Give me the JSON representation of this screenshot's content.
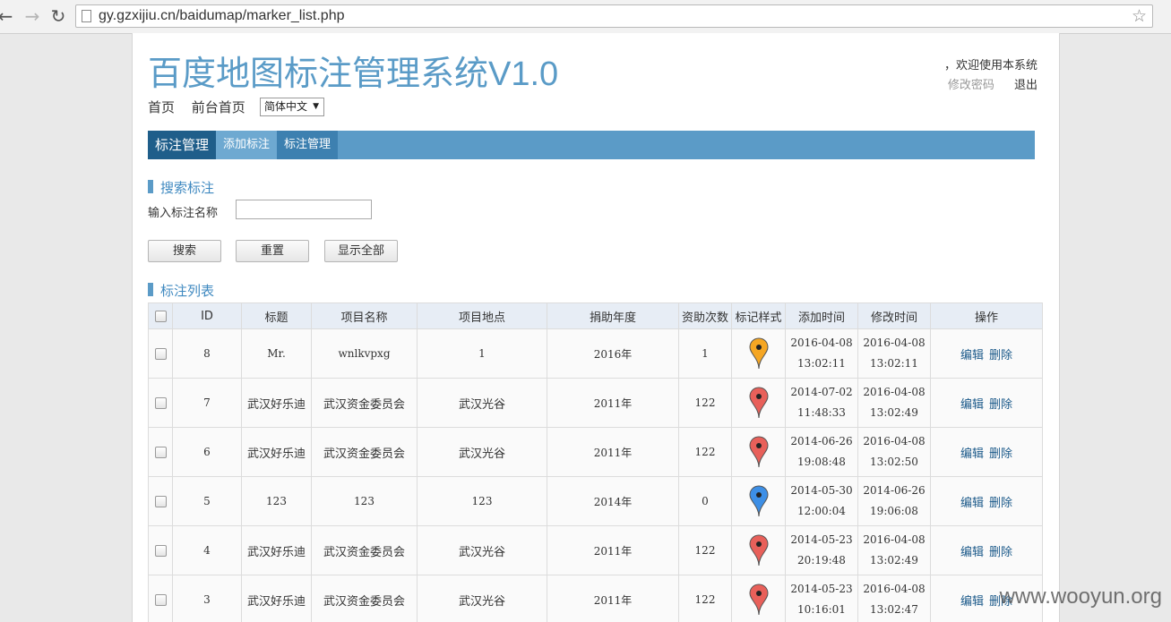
{
  "browser": {
    "url": "gy.gzxijiu.cn/baidumap/marker_list.php"
  },
  "header": {
    "title": "百度地图标注管理系统V1.0",
    "welcome": "，欢迎使用本系统",
    "change_password": "修改密码",
    "logout": "退出",
    "nav_home": "首页",
    "nav_front": "前台首页",
    "language": "简体中文"
  },
  "menu": {
    "active": "标注管理",
    "add": "添加标注",
    "manage": "标注管理"
  },
  "search": {
    "section_title": "搜索标注",
    "field_label": "输入标注名称",
    "input_value": "",
    "btn_search": "搜索",
    "btn_reset": "重置",
    "btn_show_all": "显示全部"
  },
  "list": {
    "section_title": "标注列表",
    "columns": [
      "",
      "ID",
      "标题",
      "项目名称",
      "项目地点",
      "捐助年度",
      "资助次数",
      "标记样式",
      "添加时间",
      "修改时间",
      "操作"
    ],
    "edit_label": "编辑",
    "delete_label": "删除",
    "rows": [
      {
        "id": "8",
        "title": "Mr.",
        "project": "wnlkvpxg",
        "location": "1",
        "year": "2016年",
        "count": "1",
        "marker": "orange",
        "added_date": "2016-04-08",
        "added_time": "13:02:11",
        "modified_date": "2016-04-08",
        "modified_time": "13:02:11"
      },
      {
        "id": "7",
        "title": "武汉好乐迪",
        "project": "武汉资金委员会",
        "location": "武汉光谷",
        "year": "2011年",
        "count": "122",
        "marker": "red",
        "added_date": "2014-07-02",
        "added_time": "11:48:33",
        "modified_date": "2016-04-08",
        "modified_time": "13:02:49"
      },
      {
        "id": "6",
        "title": "武汉好乐迪",
        "project": "武汉资金委员会",
        "location": "武汉光谷",
        "year": "2011年",
        "count": "122",
        "marker": "red",
        "added_date": "2014-06-26",
        "added_time": "19:08:48",
        "modified_date": "2016-04-08",
        "modified_time": "13:02:50"
      },
      {
        "id": "5",
        "title": "123",
        "project": "123",
        "location": "123",
        "year": "2014年",
        "count": "0",
        "marker": "blue",
        "added_date": "2014-05-30",
        "added_time": "12:00:04",
        "modified_date": "2014-06-26",
        "modified_time": "19:06:08"
      },
      {
        "id": "4",
        "title": "武汉好乐迪",
        "project": "武汉资金委员会",
        "location": "武汉光谷",
        "year": "2011年",
        "count": "122",
        "marker": "red",
        "added_date": "2014-05-23",
        "added_time": "20:19:48",
        "modified_date": "2016-04-08",
        "modified_time": "13:02:49"
      },
      {
        "id": "3",
        "title": "武汉好乐迪",
        "project": "武汉资金委员会",
        "location": "武汉光谷",
        "year": "2011年",
        "count": "122",
        "marker": "red",
        "added_date": "2014-05-23",
        "added_time": "10:16:01",
        "modified_date": "2016-04-08",
        "modified_time": "13:02:47"
      }
    ]
  },
  "marker_colors": {
    "orange": "#f5a623",
    "red": "#e8605a",
    "blue": "#3d8fe6"
  },
  "watermark": "www.wooyun.org"
}
